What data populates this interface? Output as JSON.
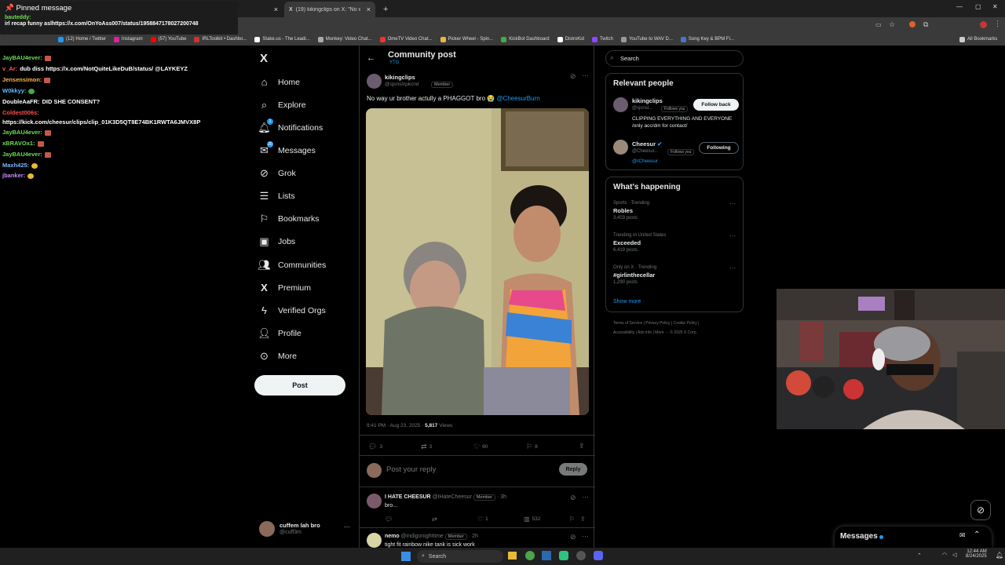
{
  "browser": {
    "tabs": [
      {
        "label": "",
        "close": "×"
      },
      {
        "label": "(19) kikingclips on X: \"No way u...",
        "close": "×"
      }
    ],
    "new_tab": "+",
    "bookmarks": [
      "(12) Home / Twitter",
      "Instagram",
      "(57) YouTube",
      "IRLToolkit • Dashbo...",
      "Stake.us - The Leadi...",
      "Monkey: Video Chat...",
      "OmeTV Video Chat...",
      "Picker Wheel - Spin...",
      "KickBot Dashboard",
      "DistroKid",
      "Twitch",
      "YouTube to WAV D...",
      "Song Key & BPM Fi..."
    ],
    "all_bookmarks": "All Bookmarks"
  },
  "chat": {
    "pinned_title": "Pinned message",
    "pinned_user": "bauteddy:",
    "pinned_text": "irl recap funny aslhttps://x.com/OnYoAss007/status/1958847178027200748",
    "messages": [
      {
        "user": "JayBAU4ever:",
        "text": "",
        "color": "#6fdc53"
      },
      {
        "user": "v_Ar:",
        "text": "dub diss https://x.com/NotQuiteLikeDuB/status/ @LAYKEYZ",
        "color": "#ff5b5b"
      },
      {
        "user": "Jensensimon:",
        "text": "",
        "color": "#ffb347"
      },
      {
        "user": "W0kkyy:",
        "text": "",
        "color": "#5bc0ff"
      },
      {
        "user": "DoubleAaFR:",
        "text": "DID SHE CONSENT?",
        "color": "#ffffff"
      },
      {
        "user": "Coldest006s:",
        "text": "",
        "color": "#ff4d4d"
      },
      {
        "user": "",
        "text": "https://kick.com/cheesur/clips/clip_01K3D5QT8E74BK1RWTA6JMVX8P",
        "color": "#ffffff"
      },
      {
        "user": "JayBAU4ever:",
        "text": "",
        "color": "#6fdc53"
      },
      {
        "user": "xBRAVOx1:",
        "text": "",
        "color": "#6fdc53"
      },
      {
        "user": "JayBAU4ever:",
        "text": "",
        "color": "#6fdc53"
      },
      {
        "user": "Maxh425:",
        "text": "",
        "color": "#7ab8ff"
      },
      {
        "user": "jbanker:",
        "text": "",
        "color": "#c78bff"
      }
    ]
  },
  "nav": {
    "logo": "X",
    "items": [
      {
        "label": "Home",
        "icon": "home-icon"
      },
      {
        "label": "Explore",
        "icon": "search-icon"
      },
      {
        "label": "Notifications",
        "icon": "bell-icon",
        "badge": "1"
      },
      {
        "label": "Messages",
        "icon": "mail-icon",
        "badge": "20"
      },
      {
        "label": "Grok",
        "icon": "grok-icon"
      },
      {
        "label": "Lists",
        "icon": "list-icon"
      },
      {
        "label": "Bookmarks",
        "icon": "bookmark-icon"
      },
      {
        "label": "Jobs",
        "icon": "briefcase-icon"
      },
      {
        "label": "Communities",
        "icon": "people-icon"
      },
      {
        "label": "Premium",
        "icon": "x-icon"
      },
      {
        "label": "Verified Orgs",
        "icon": "lightning-icon"
      },
      {
        "label": "Profile",
        "icon": "person-icon"
      },
      {
        "label": "More",
        "icon": "more-circle-icon"
      }
    ],
    "post_button": "Post",
    "account_name": "cuffem lah bro",
    "account_handle": "@cuff3m",
    "account_more": "···"
  },
  "main": {
    "header_title": "Community post",
    "header_sub": "YTG",
    "post": {
      "author": "kikingclips",
      "handle": "@sjsnslzpkcnd",
      "member": "Member",
      "text": "No way ur brother actully a PHAGGOT bro 😭",
      "mention": "@CheesurBurn",
      "time": "9:41 PM · Aug 23, 2025 ·",
      "views_count": "5,817",
      "views_label": "Views",
      "replies": "3",
      "reposts": "3",
      "likes": "90",
      "bookmarks": "8"
    },
    "reply_placeholder": "Post your reply",
    "reply_button": "Reply",
    "replies": [
      {
        "author": "I HATE CHEESUR",
        "handle": "@IHateCheesur",
        "member": "Member",
        "age": "· 3h",
        "text": "bro...",
        "likes": "1",
        "views": "532"
      },
      {
        "author": "nemo",
        "handle": "@indigonighttime",
        "member": "Member",
        "age": "· 2h",
        "text": "tight fit rainbow nike tank is sick work"
      }
    ]
  },
  "right": {
    "search_placeholder": "Search",
    "relevant_title": "Relevant people",
    "people": [
      {
        "name": "kikingclips",
        "handle": "@sjsnsl...",
        "follows_you": "Follows you",
        "button": "Follow back",
        "bio": "CLIPPING EVERYTHING AND EVERYONE /only acc/dm for contact/"
      },
      {
        "name": "Cheesur",
        "handle": "@Cheesur...",
        "follows_you": "Follows you",
        "button": "Following",
        "bio": "@ICheesur"
      }
    ],
    "happening_title": "What's happening",
    "trends": [
      {
        "context": "Sports · Trending",
        "name": "Robles",
        "posts": "3,403 posts"
      },
      {
        "context": "Trending in United States",
        "name": "Exceeded",
        "posts": "6,419 posts"
      },
      {
        "context": "Only on X · Trending",
        "name": "#girlinthecellar",
        "posts": "1,290 posts"
      }
    ],
    "show_more": "Show more",
    "footer_line1": "Terms of Service  |  Privacy Policy  |  Cookie Policy  |",
    "footer_line2": "Accessibility  |  Ads info  |  More ···  © 2025 X Corp.",
    "messages_label": "Messages"
  },
  "taskbar": {
    "search": "Search",
    "time": "12:44 AM",
    "date": "8/24/2025"
  }
}
